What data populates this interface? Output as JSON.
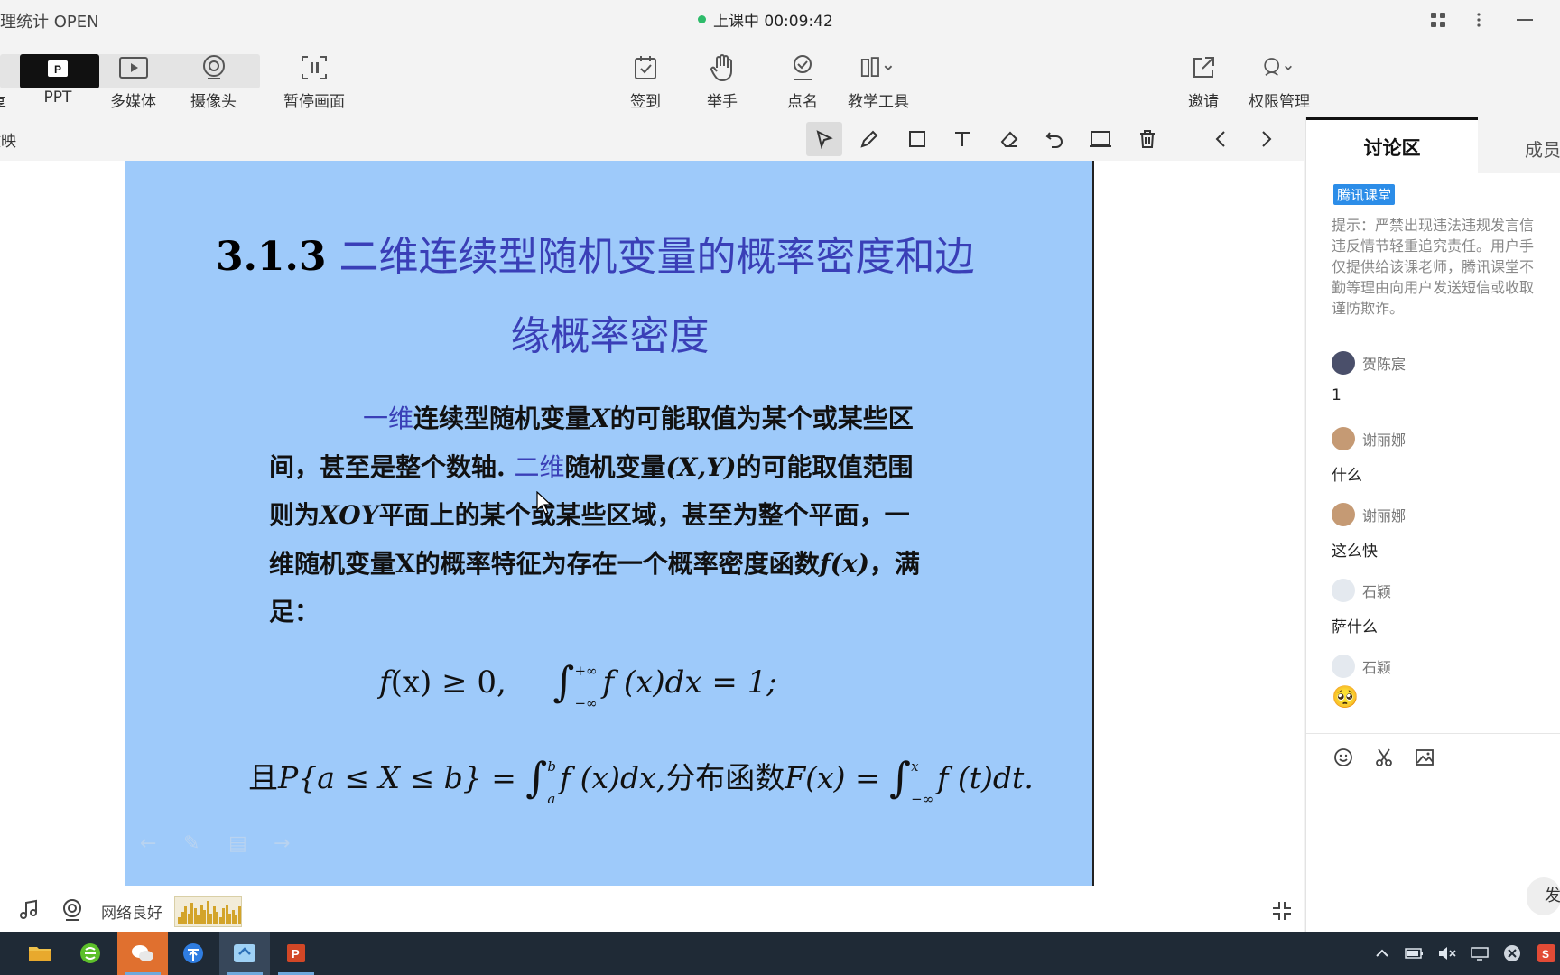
{
  "window": {
    "title": "数理统计 OPEN",
    "title_visible": "数理统计 OPEN",
    "status_text": "上课中 00:09:42"
  },
  "toolbar": {
    "share_label": "享",
    "ppt_label": "PPT",
    "media_label": "多媒体",
    "camera_label": "摄像头",
    "pause_label": "暂停画面",
    "signin_label": "签到",
    "raise_hand_label": "举手",
    "roll_call_label": "点名",
    "teaching_tools_label": "教学工具",
    "invite_label": "邀请",
    "permissions_label": "权限管理"
  },
  "subbar": {
    "label": "放映"
  },
  "slide": {
    "title_number": "3.1.3",
    "title_line1": "二维连续型随机变量的概率密度和边",
    "title_line2": "缘概率密度",
    "line1_blue": "一维",
    "line1_rest": "连续型随机变量",
    "line1_var": "X",
    "line1_end": "的可能取值为某个或某些区",
    "line2_start": "间，甚至是整个数轴. ",
    "line2_blue": "二维",
    "line2_mid": "随机变量",
    "line2_var": "(X,Y)",
    "line2_end": "的可能取值范围",
    "line3_start": "则为",
    "line3_var": "XOY",
    "line3_end": "平面上的某个或某些区域，甚至为整个平面，一",
    "line4_start": "维随机变量",
    "line4_var": "X",
    "line4_mid": "的概率特征为存在一个概率密度函数",
    "line4_fx": "f(x)",
    "line4_end": "，满",
    "line5": "足：",
    "formula1_a": "f",
    "formula1_b": "(x) ≥ 0,",
    "formula1_int": "∫",
    "formula1_upper": "+∞",
    "formula1_lower": "−∞",
    "formula1_c": "f (x)dx = 1;",
    "formula2_a": "且",
    "formula2_b": "P{a ≤ X ≤ b} =",
    "formula2_int": "∫",
    "formula2_upper": "b",
    "formula2_lower": "a",
    "formula2_c": "f (x)dx,",
    "formula2_d": "分布函数",
    "formula2_e": "F(x) =",
    "formula2_int2": "∫",
    "formula2_upper2": "x",
    "formula2_lower2": "−∞",
    "formula2_f": "f (t)dt."
  },
  "statusbar": {
    "network_label": "网络良好"
  },
  "panel": {
    "tab_discuss": "讨论区",
    "tab_members": "成员",
    "brand_badge": "腾讯课堂",
    "notice_lines": [
      "提示：严禁出现违法违规发言信",
      "违反情节轻重追究责任。用户手",
      "仅提供给该课老师，腾讯课堂不",
      "勤等理由向用户发送短信或收取",
      "谨防欺诈。"
    ],
    "messages": [
      {
        "name": "贺陈宸",
        "text": "1"
      },
      {
        "name": "谢丽娜",
        "text": "什么"
      },
      {
        "name": "谢丽娜",
        "text": "这么快"
      },
      {
        "name": "石颖",
        "text": "萨什么"
      },
      {
        "name": "石颖",
        "text": "🥺"
      }
    ],
    "send_label": "发"
  },
  "colors": {
    "slide_bg": "#9ecafa",
    "slide_blue_text": "#3a3fb7",
    "live_dot": "#2dbb6a",
    "brand_badge": "#2c8de8",
    "taskbar": "#1f2a36"
  },
  "icons": {
    "toolbar": [
      "ppt-icon",
      "play-icon",
      "camera-icon",
      "pause-screen-icon",
      "signin-icon",
      "hand-icon",
      "rollcall-icon",
      "tools-icon",
      "invite-icon",
      "permissions-icon"
    ],
    "draw_tools": [
      "pointer-icon",
      "pen-icon",
      "rectangle-icon",
      "text-icon",
      "eraser-icon",
      "undo-icon",
      "board-icon",
      "trash-icon",
      "prev-icon",
      "next-icon"
    ],
    "panel_tools": [
      "emoji-icon",
      "scissors-icon",
      "image-icon"
    ]
  }
}
